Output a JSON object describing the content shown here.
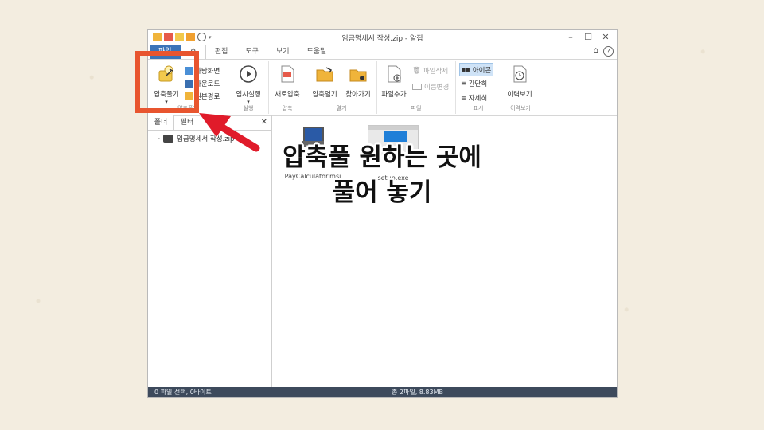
{
  "window": {
    "title": "임금명세서 작성.zip - 알집",
    "controls": {
      "minimize": "–",
      "maximize": "☐",
      "close": "✕"
    }
  },
  "tabs": [
    {
      "label": "파일"
    },
    {
      "label": "홈"
    },
    {
      "label": "편집"
    },
    {
      "label": "도구"
    },
    {
      "label": "보기"
    },
    {
      "label": "도움말"
    }
  ],
  "tabs_right": {
    "collapse": "⌂",
    "help": "?"
  },
  "ribbon": {
    "extract": {
      "label": "압축풀기",
      "dropdown": "▾",
      "sub": [
        {
          "label": "바탕화면"
        },
        {
          "label": "다운로드"
        },
        {
          "label": "원본경로"
        }
      ],
      "group": "압축풀기"
    },
    "run": {
      "label": "임시실행",
      "dropdown": "▾",
      "group": "실행"
    },
    "compress": {
      "label": "새로압축",
      "group": "압축"
    },
    "open": {
      "items": [
        {
          "label": "압축열기"
        },
        {
          "label": "찾아가기"
        }
      ],
      "group": "열기"
    },
    "file": {
      "add": "파일추가",
      "delete": "파일삭제",
      "rename": "이름변경",
      "group": "파일"
    },
    "view": {
      "icons": "아이콘",
      "simple": "간단히",
      "detail": "자세히",
      "group": "표시"
    },
    "history": {
      "label": "이력보기",
      "group": "이력보기"
    }
  },
  "left_pane": {
    "tabs": [
      {
        "label": "폴더"
      },
      {
        "label": "필터"
      }
    ],
    "close": "✕",
    "tree_item": "임금명세서 작성.zip"
  },
  "files": [
    {
      "name": "PayCalculator.msi"
    },
    {
      "name": "setup.exe"
    }
  ],
  "status": {
    "left": "0 파일 선택, 0바이트",
    "right": "총 2파일, 8.83MB"
  },
  "annotation": {
    "line1": "압축풀 원하는 곳에",
    "line2": "풀어 놓기"
  },
  "colors": {
    "accent": "#e8552f",
    "file_tab": "#3b74b8",
    "status_bg": "#3d4a5c",
    "arrow": "#e01b2a"
  }
}
